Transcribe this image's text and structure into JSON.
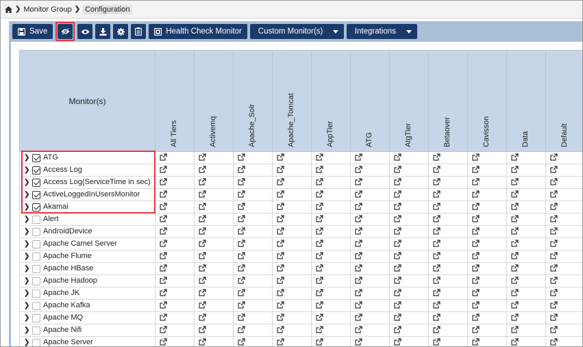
{
  "breadcrumb": {
    "home_icon": "home-icon",
    "items": [
      "Monitor Group",
      "Configuration"
    ]
  },
  "toolbar": {
    "save_label": "Save",
    "health_check_label": "Health Check Monitor",
    "custom_monitors_label": "Custom Monitor(s)",
    "integrations_label": "Integrations",
    "icons": [
      "save-icon",
      "eye-slash-icon",
      "eye-icon",
      "download-icon",
      "gear-icon",
      "clipboard-icon",
      "health-check-icon"
    ]
  },
  "table": {
    "first_header": "Monitor(s)",
    "columns": [
      "All Tiers",
      "Activemq",
      "Apache_Solr",
      "Apache_Tomcat",
      "AppTier",
      "ATG",
      "AtgTier",
      "Betaover",
      "Cavisson",
      "Data",
      "Default"
    ],
    "rows": [
      {
        "name": "ATG",
        "checked": true
      },
      {
        "name": "Access Log",
        "checked": true
      },
      {
        "name": "Access Log(ServiceTime in sec)",
        "checked": true
      },
      {
        "name": "ActiveLoggedInUsersMonitor",
        "checked": true
      },
      {
        "name": "Akamai",
        "checked": true
      },
      {
        "name": "Alert",
        "checked": false
      },
      {
        "name": "AndroidDevice",
        "checked": false
      },
      {
        "name": "Apache Camel Server",
        "checked": false
      },
      {
        "name": "Apache Flume",
        "checked": false
      },
      {
        "name": "Apache HBase",
        "checked": false
      },
      {
        "name": "Apache Hadoop",
        "checked": false
      },
      {
        "name": "Apache JK",
        "checked": false
      },
      {
        "name": "Apache Kafka",
        "checked": false
      },
      {
        "name": "Apache MQ",
        "checked": false
      },
      {
        "name": "Apache Nifi",
        "checked": false
      },
      {
        "name": "Apache Server",
        "checked": false
      }
    ],
    "cell_icon": "external-link-icon"
  },
  "colors": {
    "toolbar_button": "#1b3a6b",
    "panel_background": "#a8bfd6",
    "header_background": "#c6d5e7",
    "highlight": "#e8323c"
  }
}
